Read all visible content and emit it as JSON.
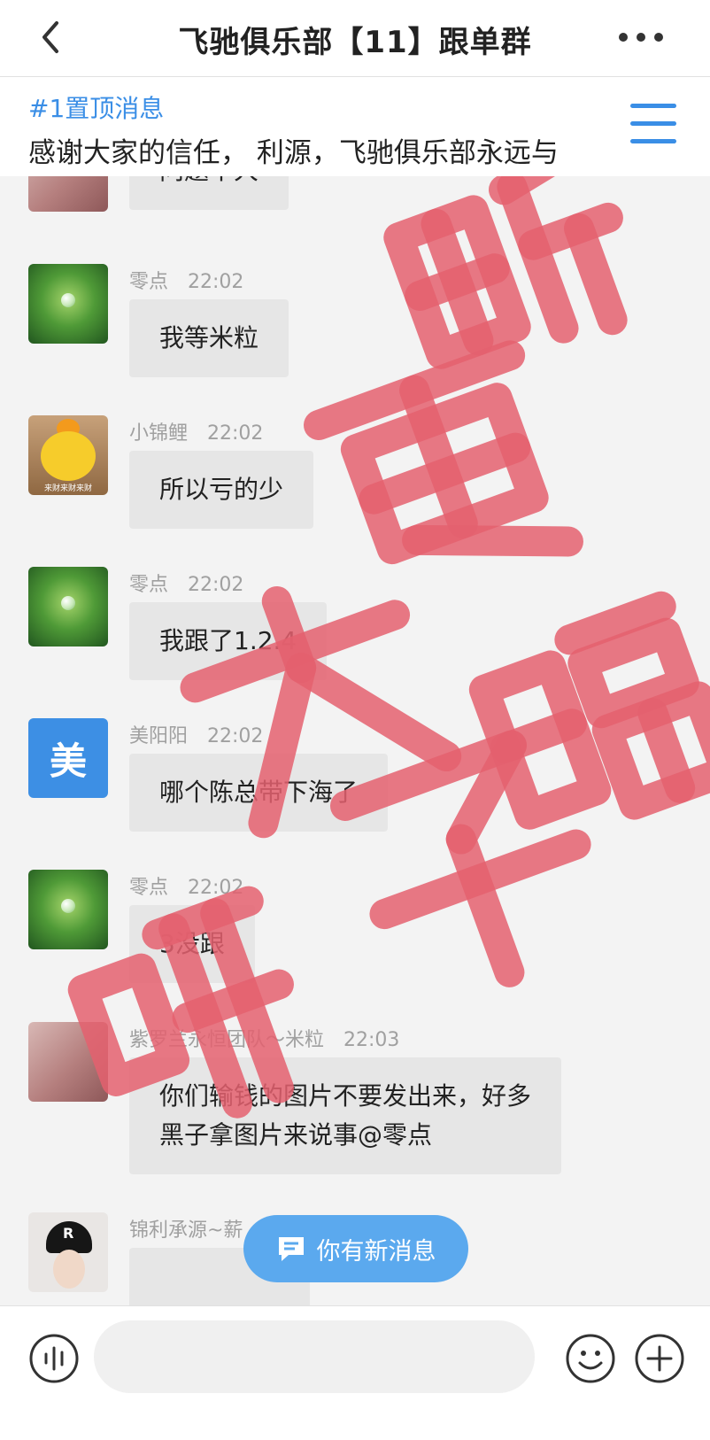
{
  "header": {
    "title": "飞驰俱乐部【11】跟单群"
  },
  "pinned": {
    "tag": "#1置顶消息",
    "text": "感谢大家的信任， 利源，飞驰俱乐部永远与"
  },
  "messages": [
    {
      "name": "",
      "time": "",
      "text": "问题不大"
    },
    {
      "name": "零点",
      "time": "22:02",
      "text": "我等米粒"
    },
    {
      "name": "小锦鲤",
      "time": "22:02",
      "text": "所以亏的少",
      "avatar_label": "来财来财来财"
    },
    {
      "name": "零点",
      "time": "22:02",
      "text": "我跟了1.2.4"
    },
    {
      "name": "美阳阳",
      "time": "22:02",
      "text": "哪个陈总带下海了",
      "avatar_letter": "美"
    },
    {
      "name": "零点",
      "time": "22:02",
      "text": "3没跟"
    },
    {
      "name": "紫罗兰永恒团队～米粒",
      "time": "22:03",
      "text_line1": "你们输钱的图片不要发出来，好多",
      "text_line2": "黑子拿图片来说事@零点"
    },
    {
      "name": "锦利承源~薪",
      "time": "",
      "text": "",
      "avatar_letter": "R"
    }
  ],
  "watermark": {
    "text": "断更大骗子",
    "color": "#e4606f"
  },
  "new_message_pill": {
    "label": "你有新消息"
  },
  "input": {
    "placeholder": ""
  },
  "colors": {
    "accent": "#3a8ee6",
    "bubble": "#e6e6e6"
  }
}
